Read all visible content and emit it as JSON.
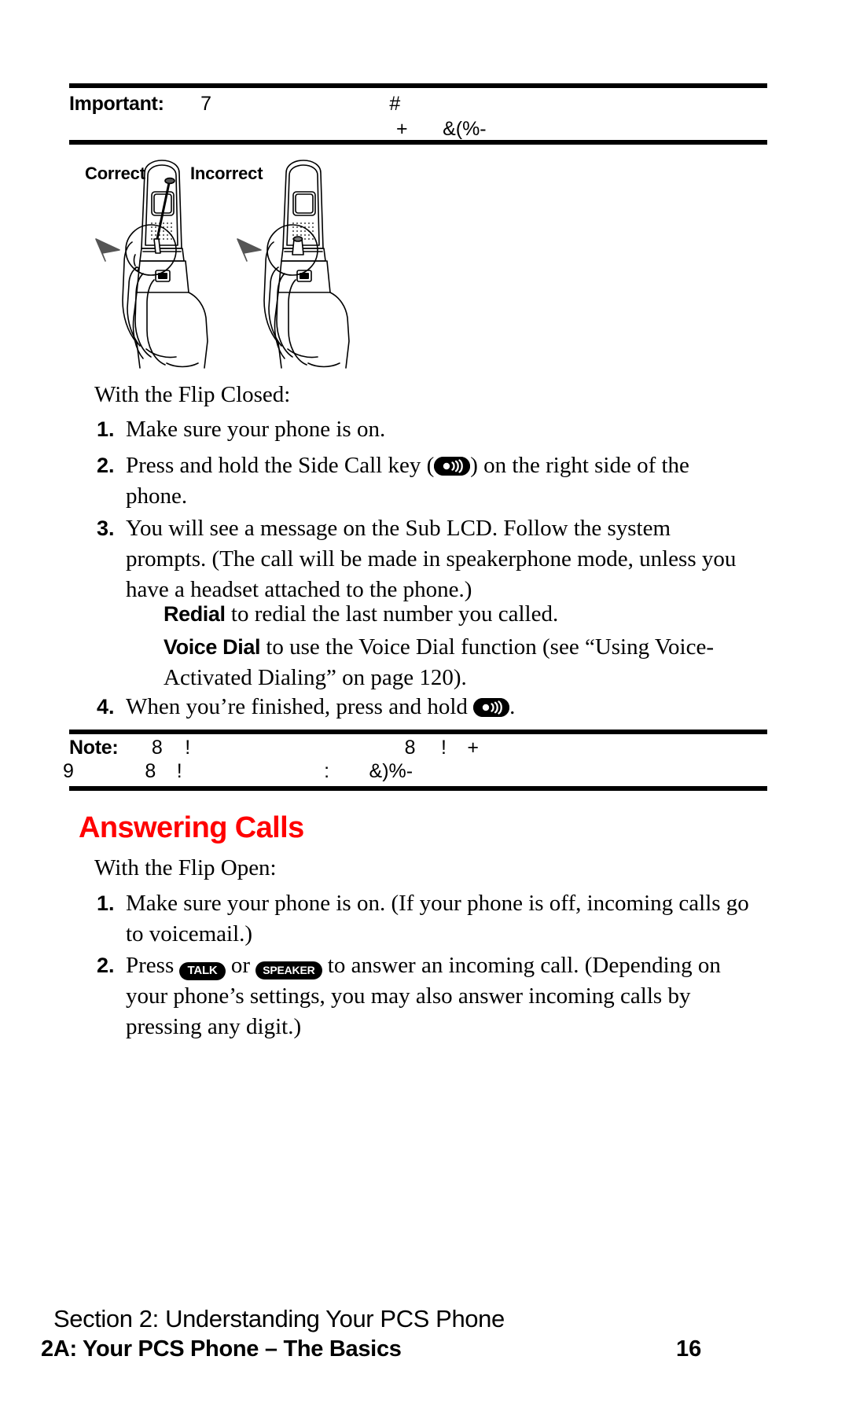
{
  "document": {
    "page_number": "16"
  },
  "important_note": {
    "label": "Important:",
    "line1_glyph_a": "7",
    "line1_glyph_b": "#",
    "line2_glyph_a": "+",
    "line2_glyph_b": "&(%-"
  },
  "figure": {
    "correct_label": "Correct",
    "incorrect_label": "Incorrect"
  },
  "flip_closed": {
    "lead_in": "With the Flip Closed:",
    "steps": [
      {
        "number": "1.",
        "text": "Make sure your phone is on."
      },
      {
        "number": "2.",
        "text_before_icon": "Press and hold the Side Call key (",
        "icon": "side-call-key-icon",
        "text_after_icon": ") on the right side of the phone."
      },
      {
        "number": "3.",
        "text": "You will see a message on the Sub LCD. Follow the system prompts. (The call will be made in speakerphone mode, unless you have a headset attached to the phone.)"
      },
      {
        "number": "4.",
        "text_before_icon": "When you’re finished, press and hold ",
        "icon": "side-call-key-icon",
        "text_after_icon": "."
      }
    ],
    "sub_items": [
      {
        "keyword": "Redial",
        "text": " to redial the last number you called."
      },
      {
        "keyword": "Voice Dial",
        "text": " to use the Voice Dial function (see “Using Voice-Activated Dialing” on page 120)."
      }
    ]
  },
  "note": {
    "label": "Note:",
    "line1_glyph_a": "8",
    "line1_glyph_b": "!",
    "line1_glyph_c": "8",
    "line1_glyph_d": "!",
    "line1_glyph_e": "+",
    "line2_glyph_a": "9",
    "line2_glyph_b": "8",
    "line2_glyph_c": "!",
    "line2_glyph_d": ":",
    "line2_glyph_e": "&)%-"
  },
  "answering_calls": {
    "heading": "Answering Calls",
    "heading_color": "#FF0000",
    "lead_in": "With the Flip Open:",
    "steps": [
      {
        "number": "1.",
        "text": "Make sure your phone is on. (If your phone is off, incoming calls go to voicemail.)"
      },
      {
        "number": "2.",
        "text_before_talk": "Press ",
        "talk_key": "TALK",
        "text_between_keys": " or ",
        "speaker_key": "SPEAKER",
        "text_after_keys": " to answer an incoming call. (Depending on your phone’s settings, you may also answer incoming calls by pressing any digit.)"
      }
    ]
  },
  "footer": {
    "section": "Section 2: Understanding Your PCS Phone",
    "chapter": "2A: Your PCS Phone – The Basics",
    "page": "16"
  }
}
